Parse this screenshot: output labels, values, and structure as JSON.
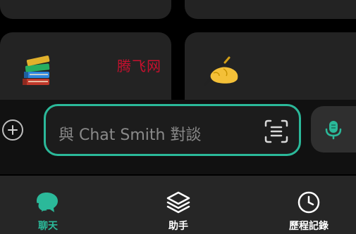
{
  "watermark": "腾飞网",
  "composer": {
    "placeholder": "與 Chat Smith 對談"
  },
  "tabs": [
    {
      "label": "聊天",
      "icon": "chat-bubbles-icon",
      "active": true
    },
    {
      "label": "助手",
      "icon": "layers-icon",
      "active": false
    },
    {
      "label": "歷程記錄",
      "icon": "clock-icon",
      "active": false
    }
  ],
  "colors": {
    "accent": "#2bb99a",
    "background": "#000000",
    "card": "#232323",
    "tab_bar": "#262626",
    "watermark": "#c8102e"
  }
}
